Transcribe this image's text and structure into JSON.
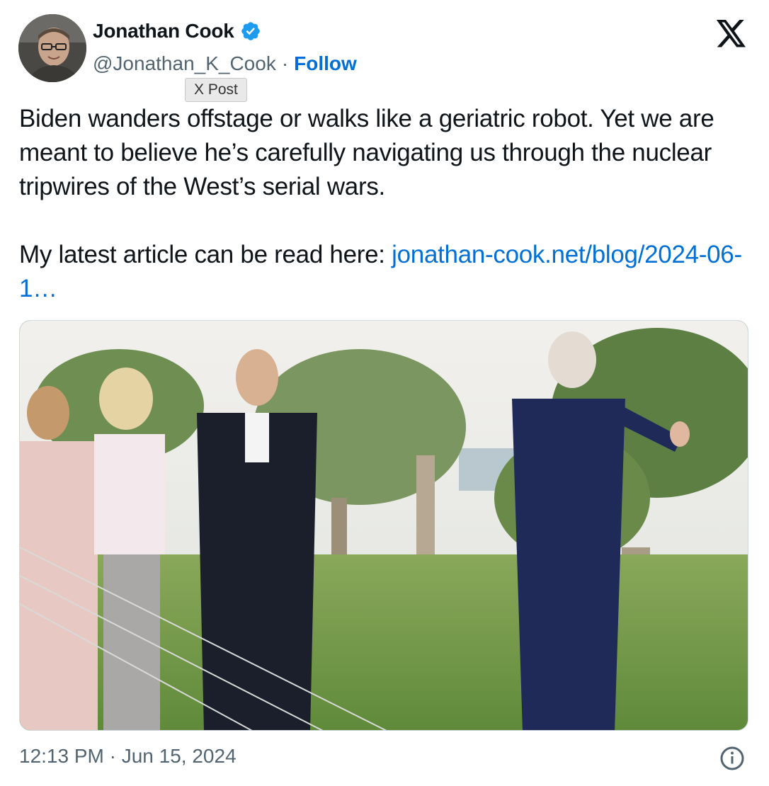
{
  "author": {
    "name": "Jonathan Cook",
    "handle": "@Jonathan_K_Cook",
    "separator": "·",
    "follow_label": "Follow",
    "verified_icon": "verified-badge-icon"
  },
  "tooltip": {
    "text": "X Post"
  },
  "brand": {
    "logo_icon": "x-logo-icon"
  },
  "tweet": {
    "line1": "Biden wanders offstage or walks like a geriatric robot. Yet we are meant to believe he’s carefully navigating us through the nuclear tripwires of the West’s serial wars.",
    "line2_prefix": "My latest article can be read here: ",
    "link_text": "jonathan-cook.net/blog/2024-06-1…"
  },
  "media": {
    "icon": "photo-icon"
  },
  "footer": {
    "timestamp": "12:13 PM · Jun 15, 2024",
    "info_icon": "info-icon"
  },
  "colors": {
    "link": "#006fd6",
    "verified": "#1d9bf0",
    "secondary_text": "#536471"
  }
}
